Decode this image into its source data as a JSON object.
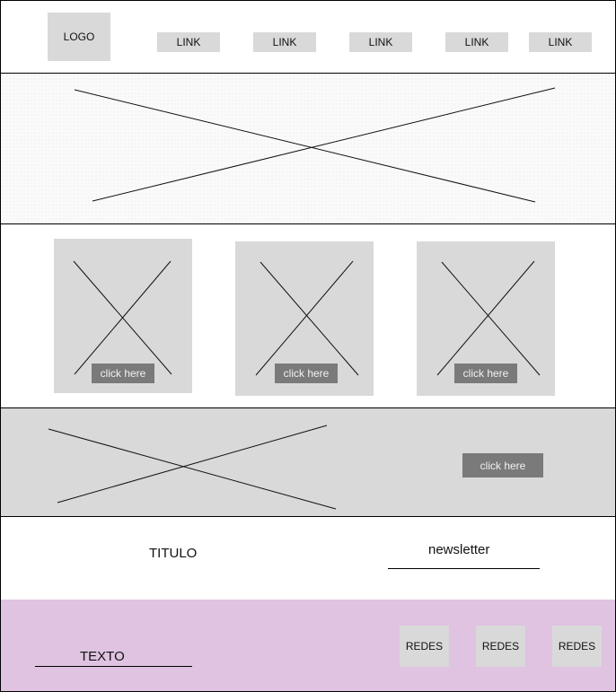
{
  "header": {
    "logo": "LOGO",
    "links": [
      "LINK",
      "LINK",
      "LINK",
      "LINK",
      "LINK"
    ]
  },
  "cards": [
    {
      "button": "click here"
    },
    {
      "button": "click here"
    },
    {
      "button": "click here"
    }
  ],
  "banner": {
    "button": "click here"
  },
  "title_row": {
    "title": "TITULO",
    "newsletter": "newsletter"
  },
  "footer": {
    "text": "TEXTO",
    "socials": [
      "REDES",
      "REDES",
      "REDES"
    ]
  },
  "colors": {
    "placeholder": "#d9d9d9",
    "button": "#7a7a7a",
    "footer": "#dfc3e1"
  }
}
